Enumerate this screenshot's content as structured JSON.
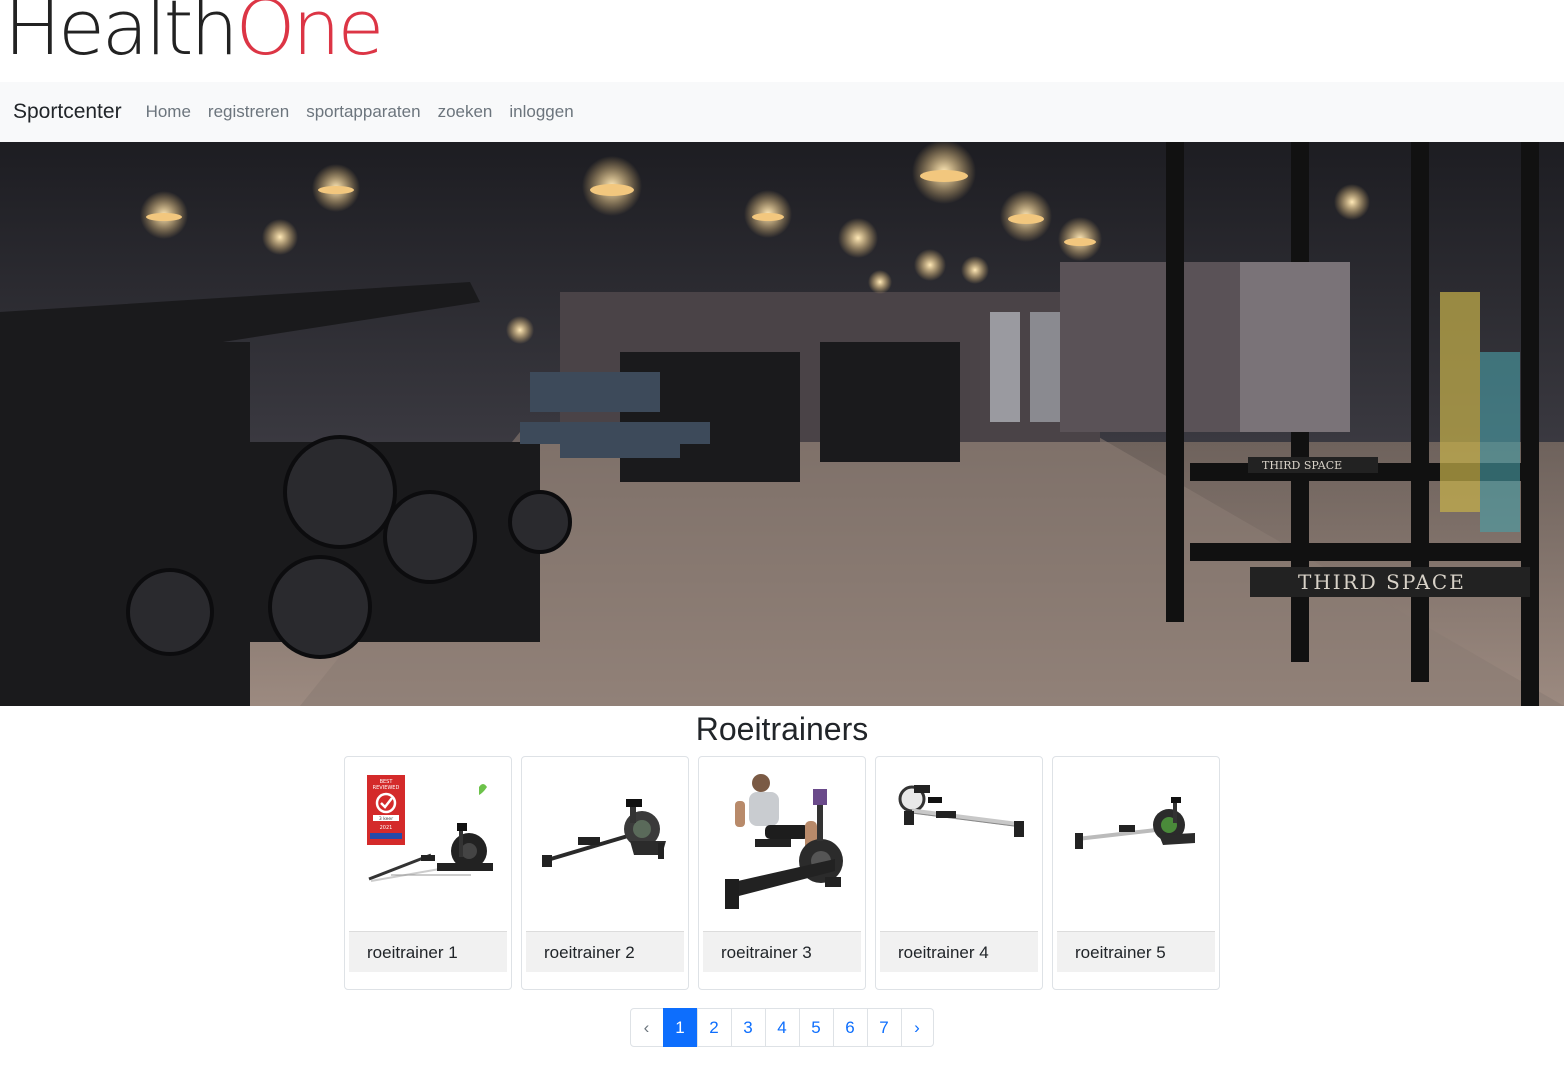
{
  "logo": {
    "part1": "Health",
    "part2": "One"
  },
  "navbar": {
    "brand": "Sportcenter",
    "links": [
      "Home",
      "registreren",
      "sportapparaten",
      "zoeken",
      "inloggen"
    ]
  },
  "hero": {
    "alt": "gym-photo",
    "signs": [
      "THIRD SPACE",
      "THIRD SPACE"
    ]
  },
  "section": {
    "title": "Roeitrainers"
  },
  "products": [
    {
      "label": "roeitrainer 1",
      "badge": [
        "BEST",
        "REVIEWED",
        "3 keer",
        "2021"
      ]
    },
    {
      "label": "roeitrainer 2"
    },
    {
      "label": "roeitrainer 3"
    },
    {
      "label": "roeitrainer 4"
    },
    {
      "label": "roeitrainer 5"
    }
  ],
  "pagination": {
    "prev": "‹",
    "pages": [
      "1",
      "2",
      "3",
      "4",
      "5",
      "6",
      "7"
    ],
    "next": "›",
    "active": "1"
  },
  "colors": {
    "brand_red": "#dc3545",
    "link_blue": "#0d6efd",
    "navbar_bg": "#f8f9fa"
  }
}
